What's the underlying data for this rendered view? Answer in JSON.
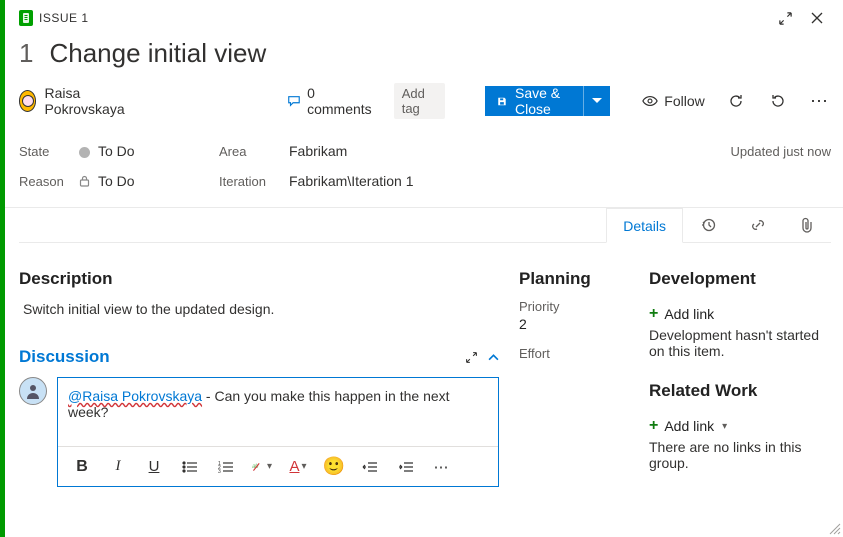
{
  "header": {
    "issue_tag": "ISSUE 1",
    "id": "1",
    "title": "Change initial view"
  },
  "meta": {
    "assignee": "Raisa Pokrovskaya",
    "comments_label": "0 comments",
    "add_tag_label": "Add tag",
    "save_label": "Save & Close",
    "follow_label": "Follow"
  },
  "info": {
    "state_label": "State",
    "state_value": "To Do",
    "reason_label": "Reason",
    "reason_value": "To Do",
    "area_label": "Area",
    "area_value": "Fabrikam",
    "iteration_label": "Iteration",
    "iteration_value": "Fabrikam\\Iteration 1",
    "updated": "Updated just now"
  },
  "tabs": {
    "details": "Details"
  },
  "description": {
    "heading": "Description",
    "text": "Switch initial view to the updated design."
  },
  "planning": {
    "heading": "Planning",
    "priority_label": "Priority",
    "priority_value": "2",
    "effort_label": "Effort"
  },
  "development": {
    "heading": "Development",
    "add_link": "Add link",
    "empty": "Development hasn't started on this item."
  },
  "related": {
    "heading": "Related Work",
    "add_link": "Add link",
    "empty": "There are no links in this group."
  },
  "discussion": {
    "heading": "Discussion",
    "mention": "@Raisa Pokrovskaya",
    "text": " - Can you make this happen in the next week?"
  }
}
